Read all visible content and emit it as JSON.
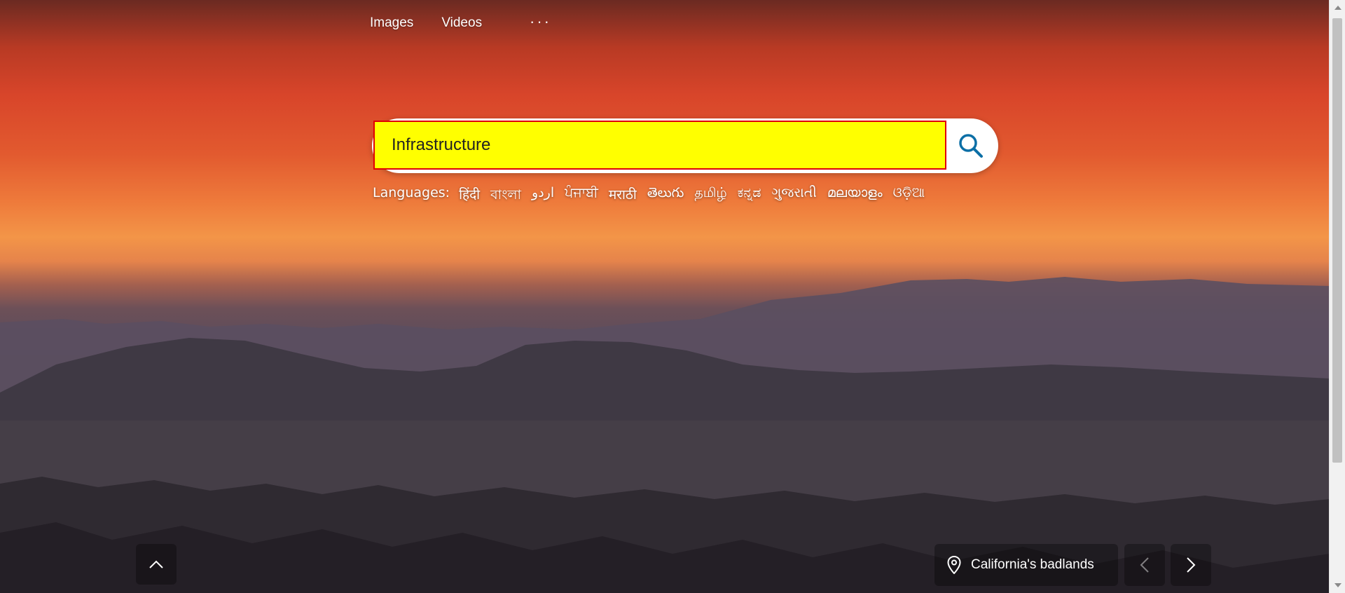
{
  "nav": {
    "images": "Images",
    "videos": "Videos",
    "more": "···"
  },
  "search": {
    "value": "Infrastructure",
    "placeholder": ""
  },
  "languages": {
    "label": "Languages:",
    "items": [
      "हिंदी",
      "বাংলা",
      "اردو",
      "ਪੰਜਾਬੀ",
      "मराठी",
      "తెలుగు",
      "தமிழ்",
      "ಕನ್ನಡ",
      "ગુજરાતી",
      "മലയാളം",
      "ଓଡ଼ିଆ"
    ]
  },
  "location": {
    "text": "California's badlands"
  },
  "icons": {
    "search": "search-icon",
    "scroll_up": "chevron-up-icon",
    "location": "location-pin-icon",
    "prev": "chevron-left-icon",
    "next": "chevron-right-icon"
  },
  "colors": {
    "search_highlight": "#ffff00",
    "search_border": "#e00000",
    "search_icon": "#0c6fa6"
  }
}
